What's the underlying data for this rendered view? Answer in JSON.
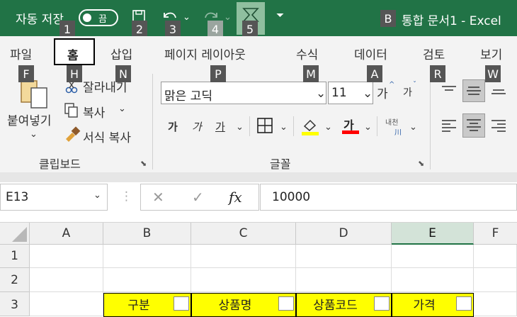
{
  "titlebar": {
    "autosave_label": "자동 저장",
    "autosave_toggle": "끔",
    "title": "통합 문서1  -  Excel"
  },
  "keytips": {
    "save": "1",
    "home_tab": "2",
    "undo": "3",
    "redo": "4",
    "customize": "5",
    "title": "B",
    "file": "F",
    "home": "H",
    "insert": "N",
    "layout": "P",
    "formulas": "M",
    "data": "A",
    "review": "R",
    "view": "W"
  },
  "tabs": {
    "file": "파일",
    "home": "홈",
    "insert": "삽입",
    "page_layout": "페이지 레이아웃",
    "formulas": "수식",
    "data": "데이터",
    "review": "검토",
    "view": "보기"
  },
  "clipboard": {
    "paste": "붙여넣기",
    "cut": "잘라내기",
    "copy": "복사",
    "format_painter": "서식 복사",
    "group_label": "클립보드"
  },
  "font": {
    "name": "맑은 고딕",
    "size": "11",
    "increase": "가",
    "decrease": "가",
    "bold": "가",
    "italic": "가",
    "underline": "가",
    "color_glyph": "가",
    "phonetic": "내천",
    "group_label": "글꼴"
  },
  "formula_bar": {
    "name_box": "E13",
    "fx": "fx",
    "value": "10000"
  },
  "sheet": {
    "columns": [
      "A",
      "B",
      "C",
      "D",
      "E",
      "F"
    ],
    "rows": [
      "1",
      "2",
      "3"
    ],
    "header_cells": [
      "구분",
      "상품명",
      "상품코드",
      "가격"
    ]
  },
  "colors": {
    "accent": "#217346",
    "highlight": "#ffff00",
    "font_color": "#ff0000"
  }
}
